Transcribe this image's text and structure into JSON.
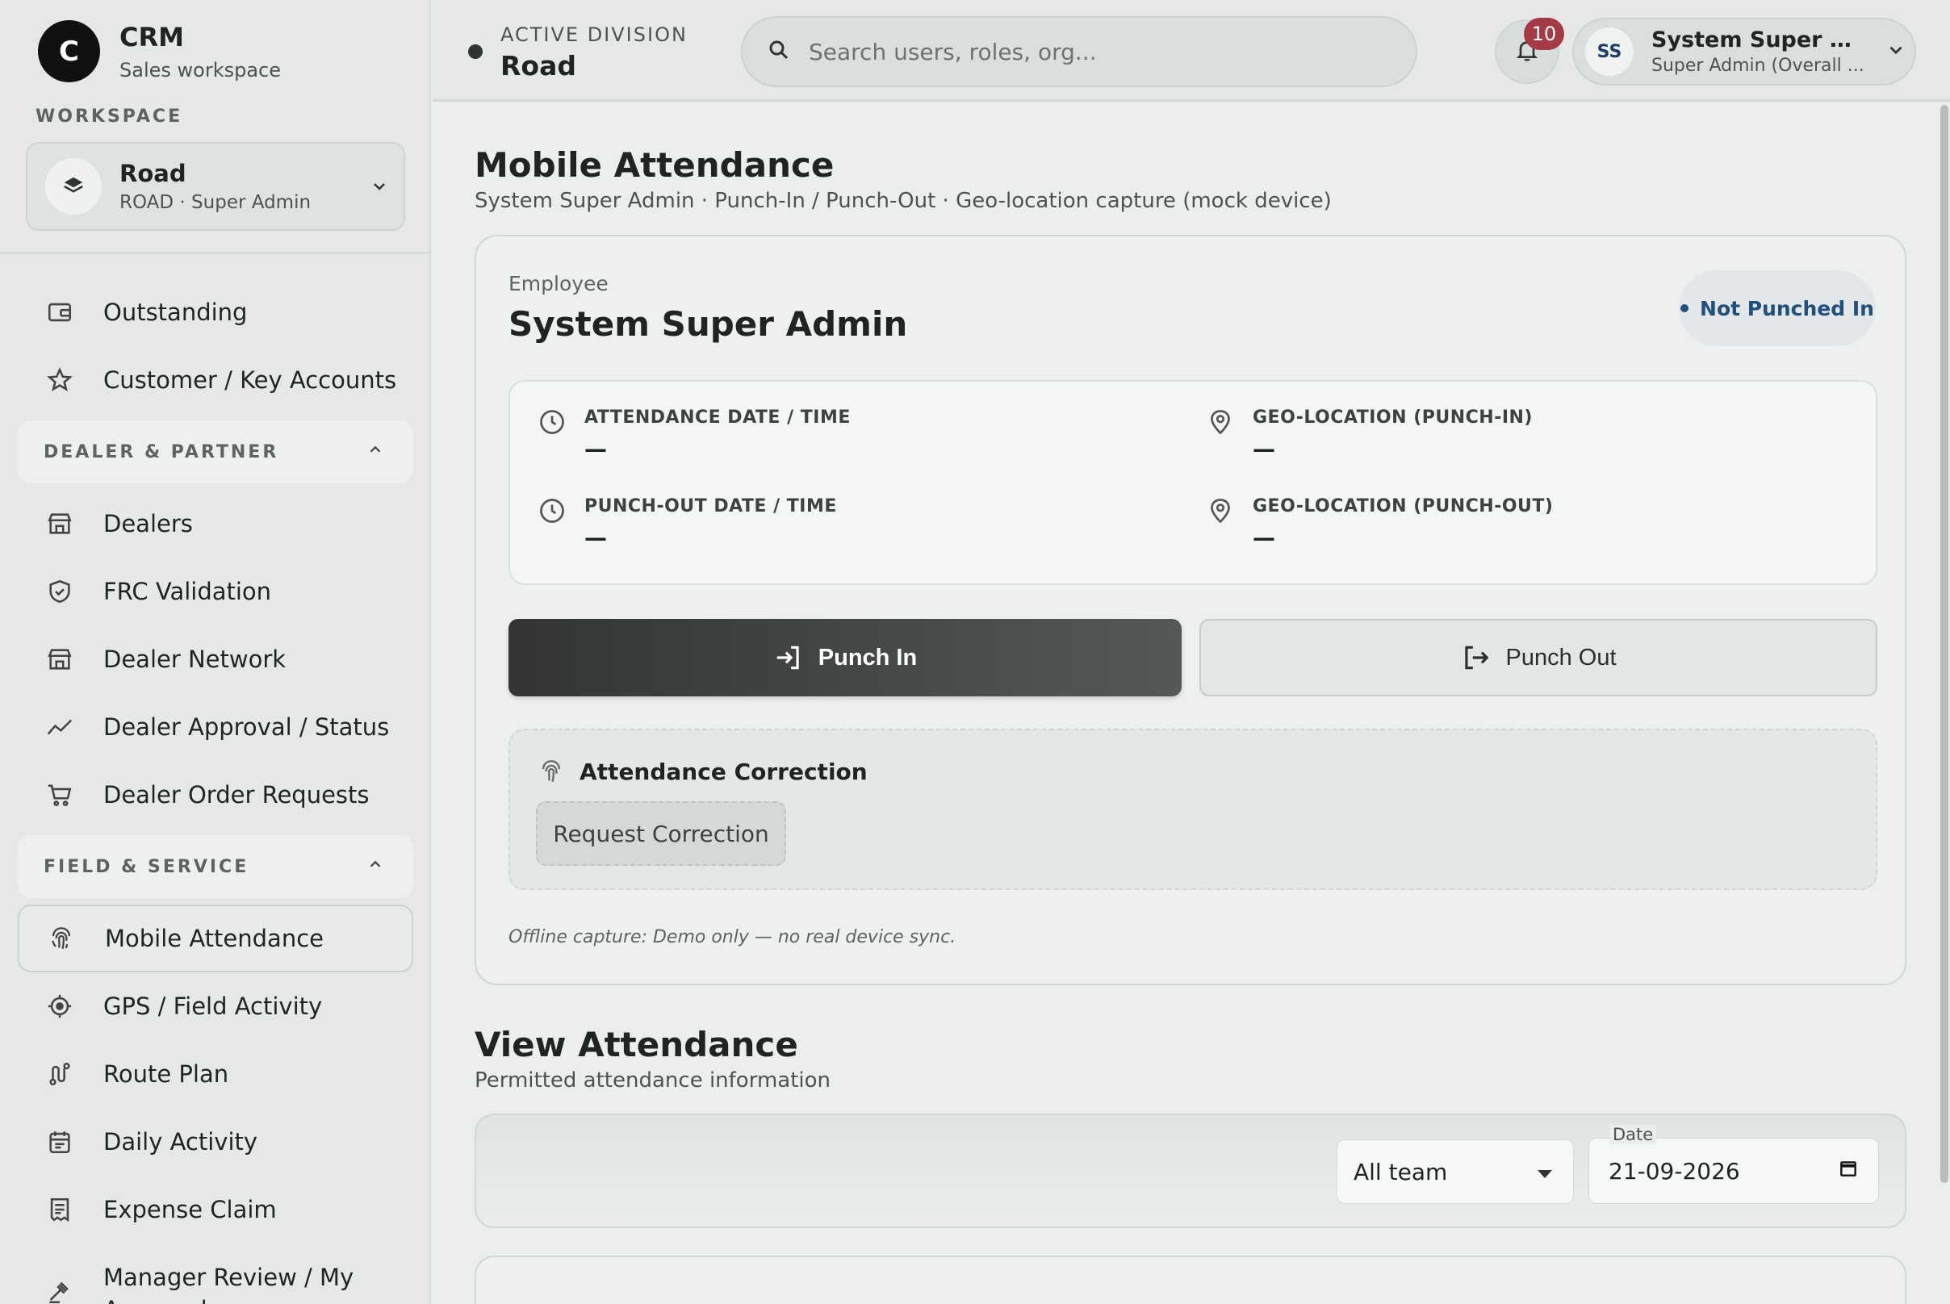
{
  "brand": {
    "logo_letter": "C",
    "name": "CRM",
    "subtitle": "Sales workspace"
  },
  "workspace": {
    "section_label": "WORKSPACE",
    "name": "Road",
    "detail": "ROAD · Super Admin"
  },
  "sidebar": {
    "items_top": [
      {
        "label": "Outstanding",
        "icon": "wallet-icon"
      },
      {
        "label": "Customer / Key Accounts",
        "icon": "star-icon"
      }
    ],
    "section_dealer": {
      "label": "DEALER & PARTNER",
      "items": [
        {
          "label": "Dealers",
          "icon": "store-icon"
        },
        {
          "label": "FRC Validation",
          "icon": "shield-check-icon"
        },
        {
          "label": "Dealer Network",
          "icon": "store-icon"
        },
        {
          "label": "Dealer Approval / Status",
          "icon": "trend-icon"
        },
        {
          "label": "Dealer Order Requests",
          "icon": "cart-icon"
        }
      ]
    },
    "section_field": {
      "label": "FIELD & SERVICE",
      "items": [
        {
          "label": "Mobile Attendance",
          "icon": "fingerprint-icon"
        },
        {
          "label": "GPS / Field Activity",
          "icon": "locate-icon"
        },
        {
          "label": "Route Plan",
          "icon": "route-icon"
        },
        {
          "label": "Daily Activity",
          "icon": "calendar-icon"
        },
        {
          "label": "Expense Claim",
          "icon": "receipt-icon"
        },
        {
          "label": "Manager Review / My Approvals",
          "icon": "gavel-icon"
        }
      ]
    }
  },
  "topbar": {
    "division_label": "ACTIVE DIVISION",
    "division_name": "Road",
    "search_placeholder": "Search users, roles, org...",
    "notification_count": "10",
    "user_initials": "SS",
    "user_name": "System Super Ad...",
    "user_role": "Super Admin (Overall ..."
  },
  "page": {
    "title": "Mobile Attendance",
    "subtitle": "System Super Admin · Punch-In / Punch-Out · Geo-location capture (mock device)"
  },
  "attendance_card": {
    "employee_label": "Employee",
    "employee_name": "System Super Admin",
    "status": "Not Punched In",
    "fields": {
      "attendance_label": "ATTENDANCE DATE / TIME",
      "attendance_value": "—",
      "geo_in_label": "GEO-LOCATION (PUNCH-IN)",
      "geo_in_value": "—",
      "punch_out_label": "PUNCH-OUT DATE / TIME",
      "punch_out_value": "—",
      "geo_out_label": "GEO-LOCATION (PUNCH-OUT)",
      "geo_out_value": "—"
    },
    "punch_in_label": "Punch In",
    "punch_out_label": "Punch Out",
    "correction_title": "Attendance Correction",
    "correction_button": "Request Correction",
    "offline_note": "Offline capture: Demo only — no real device sync."
  },
  "view_attendance": {
    "title": "View Attendance",
    "subtitle": "Permitted attendance information",
    "team_select": "All team",
    "date_label": "Date",
    "date_value": "21-09-2026"
  },
  "colors": {
    "primary_dark": "#333535",
    "badge_red": "#a43a46",
    "status_blue": "#1f4f7a"
  }
}
